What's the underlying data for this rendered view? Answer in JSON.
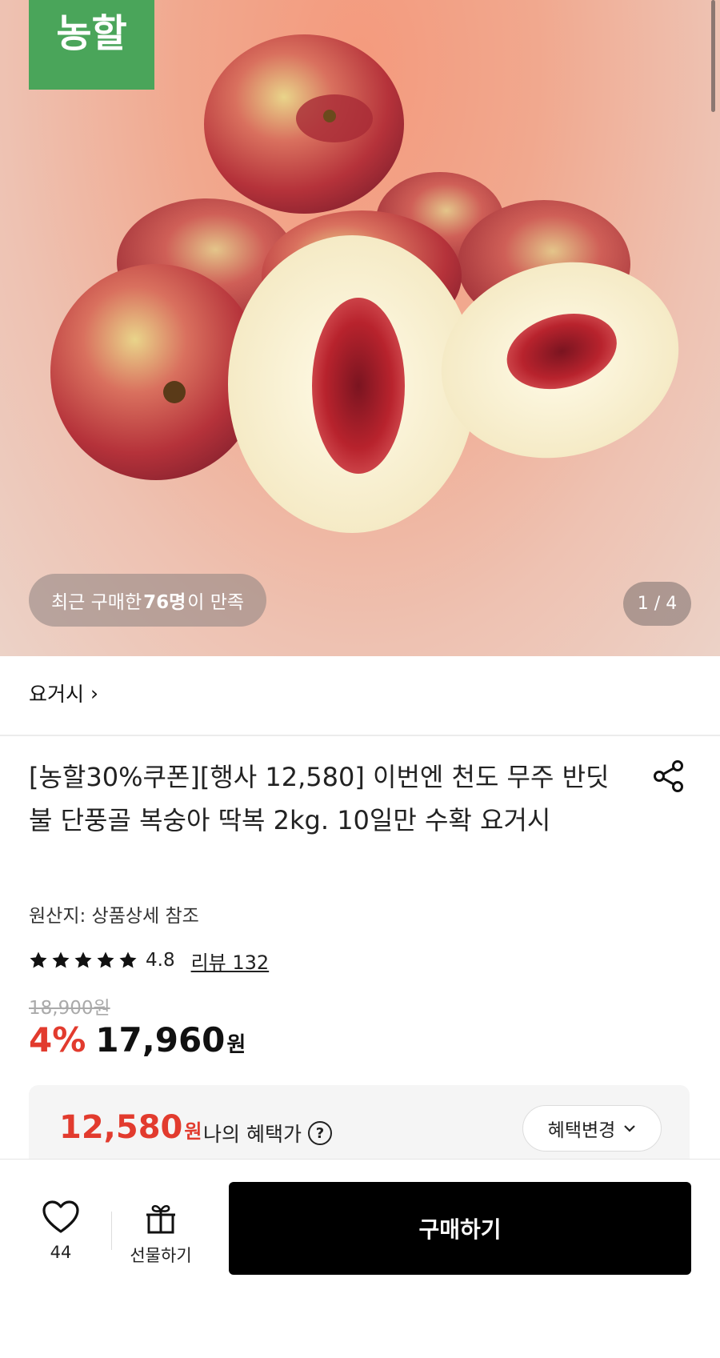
{
  "hero": {
    "brand_badge": "농할",
    "satisfy": {
      "prefix": "최근 구매한 ",
      "count": "76명",
      "suffix": "이 만족"
    },
    "pager": "1 / 4"
  },
  "store": {
    "name": "요거시",
    "chevron": "›"
  },
  "product": {
    "title": "[농할30%쿠폰][행사 12,580] 이번엔 천도 무주 반딧불 단풍골 복숭아 딱복 2kg. 10일만 수확 요거시",
    "origin": "원산지: 상품상세 참조",
    "rating": {
      "stars": 5,
      "value": "4.8",
      "review_link": "리뷰 132"
    },
    "original_price": "18,900원",
    "discount": "4%",
    "price": "17,960",
    "price_unit": "원"
  },
  "benefit": {
    "price": "12,580",
    "unit": "원",
    "label": "나의 혜택가",
    "help": "?",
    "change_button": "혜택변경"
  },
  "bottom_bar": {
    "like_count": "44",
    "gift_label": "선물하기",
    "buy_label": "구매하기"
  },
  "colors": {
    "accent_red": "#e23b2e",
    "brand_green": "#4aa55a",
    "buy_black": "#000000"
  }
}
